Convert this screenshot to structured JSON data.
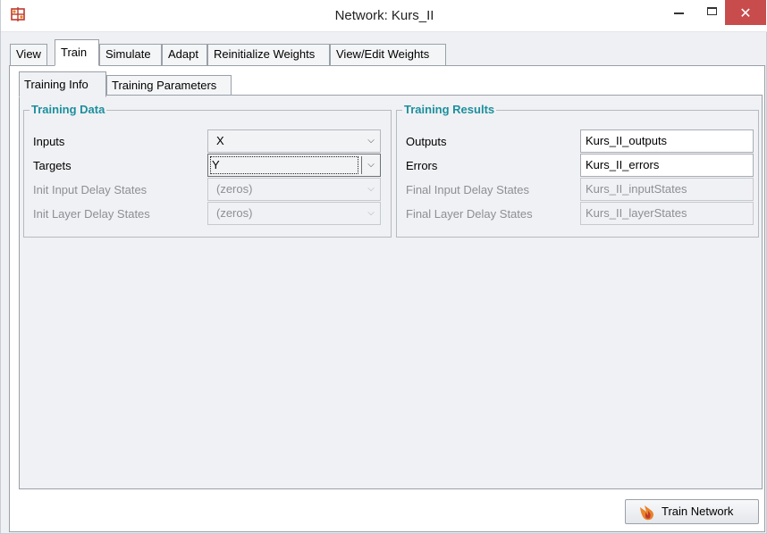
{
  "window": {
    "title": "Network: Kurs_II",
    "icon": "network-app-icon",
    "controls": {
      "minimize": "minimize-icon",
      "maximize": "maximize-icon",
      "close": "close-icon"
    }
  },
  "tabs": [
    {
      "label": "View",
      "active": false
    },
    {
      "label": "Train",
      "active": true
    },
    {
      "label": "Simulate",
      "active": false
    },
    {
      "label": "Adapt",
      "active": false
    },
    {
      "label": "Reinitialize Weights",
      "active": false
    },
    {
      "label": "View/Edit Weights",
      "active": false
    }
  ],
  "subtabs": [
    {
      "label": "Training Info",
      "active": true
    },
    {
      "label": "Training Parameters",
      "active": false
    }
  ],
  "training_data": {
    "title": "Training Data",
    "rows": [
      {
        "label": "Inputs",
        "value": "X",
        "enabled": true
      },
      {
        "label": "Targets",
        "value": "Y",
        "enabled": true,
        "focused": true
      },
      {
        "label": "Init Input Delay States",
        "value": "(zeros)",
        "enabled": false
      },
      {
        "label": "Init Layer Delay States",
        "value": "(zeros)",
        "enabled": false
      }
    ]
  },
  "training_results": {
    "title": "Training Results",
    "rows": [
      {
        "label": "Outputs",
        "value": "Kurs_II_outputs",
        "enabled": true
      },
      {
        "label": "Errors",
        "value": "Kurs_II_errors",
        "enabled": true
      },
      {
        "label": "Final Input Delay States",
        "value": "Kurs_II_inputStates",
        "enabled": false
      },
      {
        "label": "Final Layer Delay States",
        "value": "Kurs_II_layerStates",
        "enabled": false
      }
    ]
  },
  "actions": {
    "train_label": "Train Network",
    "train_icon": "train-flame-icon"
  },
  "colors": {
    "group_title": "#1c8f9e",
    "close_button": "#c84c4c"
  }
}
